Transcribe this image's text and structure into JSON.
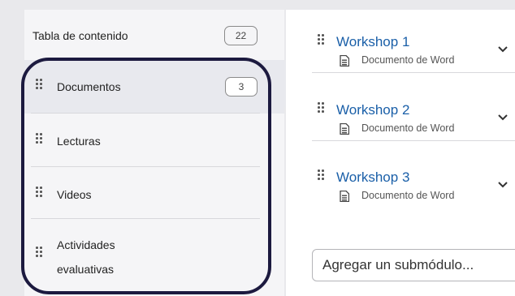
{
  "sidebar": {
    "toc_label": "Tabla de contenido",
    "toc_count": "22",
    "items": [
      {
        "label": "Documentos",
        "count": "3",
        "active": true
      },
      {
        "label": "Lecturas"
      },
      {
        "label": "Videos"
      },
      {
        "label": "Actividades evaluativas",
        "line1": "Actividades",
        "line2": "evaluativas"
      }
    ]
  },
  "modules": [
    {
      "title": "Workshop 1",
      "subtitle": "Documento de Word"
    },
    {
      "title": "Workshop 2",
      "subtitle": "Documento de Word"
    },
    {
      "title": "Workshop 3",
      "subtitle": "Documento de Word"
    }
  ],
  "add_submodule": {
    "placeholder": "Agregar un submódulo..."
  },
  "colors": {
    "link": "#1a5fa8",
    "highlight_ring": "#1c1a3f",
    "active_bg": "#e8e9ee"
  },
  "icons": [
    "grip-icon",
    "document-icon",
    "chevron-down-icon"
  ]
}
